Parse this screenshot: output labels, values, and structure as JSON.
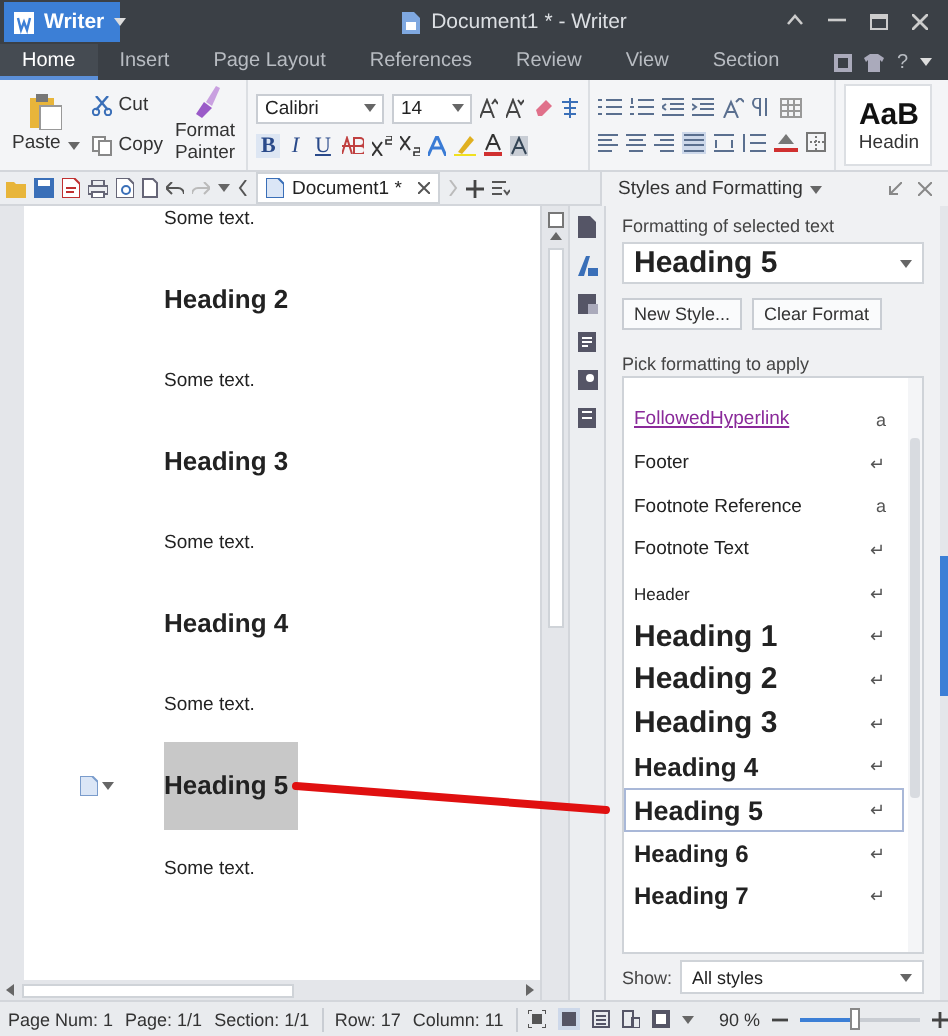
{
  "app_button": {
    "label": "Writer"
  },
  "window": {
    "title": "Document1 * - Writer"
  },
  "menu_tabs": [
    {
      "label": "Home",
      "selected": true
    },
    {
      "label": "Insert",
      "selected": false
    },
    {
      "label": "Page Layout",
      "selected": false
    },
    {
      "label": "References",
      "selected": false
    },
    {
      "label": "Review",
      "selected": false
    },
    {
      "label": "View",
      "selected": false
    },
    {
      "label": "Section",
      "selected": false
    }
  ],
  "help": "?",
  "ribbon": {
    "paste": "Paste",
    "cut": "Cut",
    "copy": "Copy",
    "format_painter": "Format Painter",
    "font": "Calibri",
    "size": "14",
    "bold": "B",
    "italic": "I",
    "underline": "U",
    "style_preview": "AaB",
    "style_name": "Headin"
  },
  "document_tab": {
    "label": "Document1 *"
  },
  "document": [
    {
      "kind": "text",
      "text": "Some text."
    },
    {
      "kind": "heading",
      "text": "Heading 2",
      "selected": false
    },
    {
      "kind": "text",
      "text": "Some text."
    },
    {
      "kind": "heading",
      "text": "Heading 3",
      "selected": false
    },
    {
      "kind": "text",
      "text": "Some text."
    },
    {
      "kind": "heading",
      "text": "Heading 4",
      "selected": false
    },
    {
      "kind": "text",
      "text": "Some text."
    },
    {
      "kind": "heading",
      "text": "Heading 5",
      "selected": true,
      "note": true
    },
    {
      "kind": "text",
      "text": "Some text."
    }
  ],
  "styles_panel": {
    "title": "Styles and Formatting",
    "selected_label": "Formatting of selected text",
    "current_style": "Heading 5",
    "buttons": [
      "New Style...",
      "Clear Format"
    ],
    "pick_label": "Pick formatting to apply",
    "styles": [
      {
        "name": "FollowedHyperlink",
        "kind": "link",
        "mark": "a",
        "selected": false
      },
      {
        "name": "Footer",
        "kind": "normal",
        "mark": "↵",
        "selected": false
      },
      {
        "name": "Footnote Reference",
        "kind": "normal",
        "mark": "a",
        "selected": false
      },
      {
        "name": "Footnote Text",
        "kind": "normal",
        "mark": "↵",
        "selected": false
      },
      {
        "name": "Header",
        "kind": "small",
        "mark": "↵",
        "selected": false
      },
      {
        "name": "Heading 1",
        "kind": "h1",
        "mark": "↵",
        "selected": false
      },
      {
        "name": "Heading 2",
        "kind": "h2",
        "mark": "↵",
        "selected": false
      },
      {
        "name": "Heading 3",
        "kind": "h3",
        "mark": "↵",
        "selected": false
      },
      {
        "name": "Heading 4",
        "kind": "h4",
        "mark": "↵",
        "selected": false
      },
      {
        "name": "Heading 5",
        "kind": "h5",
        "mark": "↵",
        "selected": true
      },
      {
        "name": "Heading 6",
        "kind": "h6",
        "mark": "↵",
        "selected": false
      },
      {
        "name": "Heading 7",
        "kind": "h7",
        "mark": "↵",
        "selected": false
      }
    ],
    "show_label": "Show:",
    "show_value": "All styles"
  },
  "status_bar": {
    "fields": [
      "Page Num: 1",
      "Page: 1/1",
      "Section: 1/1",
      "Row: 17",
      "Column: 11"
    ],
    "zoom": "90 %",
    "zoom_slider": {
      "level": 0.47
    }
  }
}
